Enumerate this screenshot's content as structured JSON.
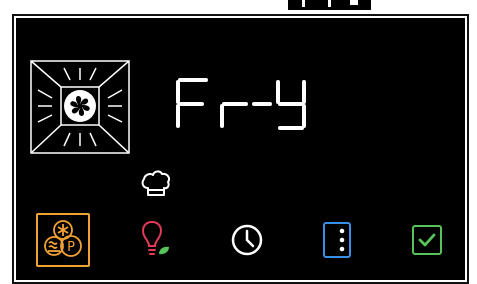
{
  "display": {
    "mode_text": "Fr-y",
    "mode_text_shown": "Fry"
  },
  "toolbar": {
    "buttons": [
      {
        "name": "heating-mode-button",
        "icon": "convection-pizza-icon",
        "selected": true,
        "color": "#f2a235"
      },
      {
        "name": "light-button",
        "icon": "light-bulb-leaf-icon",
        "selected": false,
        "color": "#e53a55"
      },
      {
        "name": "timer-button",
        "icon": "clock-icon",
        "selected": false,
        "color": "#ffffff"
      },
      {
        "name": "options-button",
        "icon": "vertical-dots-icon",
        "selected": false,
        "color": "#3a8ee6"
      },
      {
        "name": "confirm-button",
        "icon": "checkmark-icon",
        "selected": false,
        "color": "#57c45a"
      }
    ]
  },
  "colors": {
    "background": "#000000",
    "foreground": "#ffffff",
    "accent_orange": "#f2a235",
    "accent_red": "#e53a55",
    "accent_blue": "#3a8ee6",
    "accent_green": "#57c45a"
  }
}
